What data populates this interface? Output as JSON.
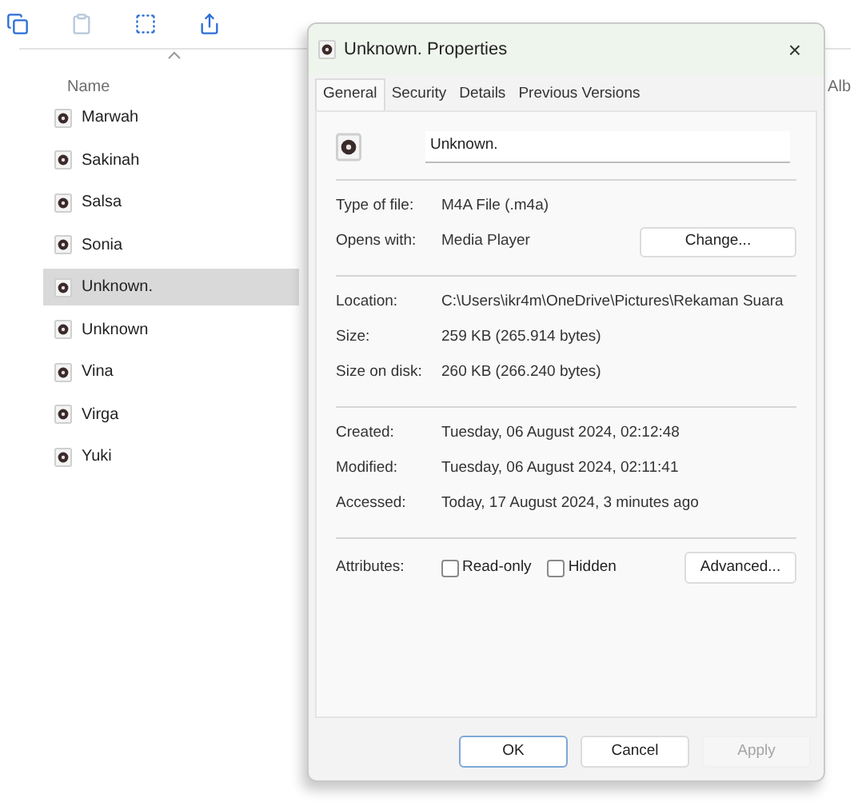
{
  "explorer": {
    "columns": [
      {
        "label": "Name",
        "sorted": true
      },
      {
        "label": "Alb",
        "sorted": false
      }
    ],
    "files": [
      {
        "name": "Marwah",
        "selected": false
      },
      {
        "name": "Sakinah",
        "selected": false
      },
      {
        "name": "Salsa",
        "selected": false
      },
      {
        "name": "Sonia",
        "selected": false
      },
      {
        "name": "Unknown.",
        "selected": true
      },
      {
        "name": "Unknown",
        "selected": false
      },
      {
        "name": "Vina",
        "selected": false
      },
      {
        "name": "Virga",
        "selected": false
      },
      {
        "name": "Yuki",
        "selected": false
      }
    ]
  },
  "dialog": {
    "title": "Unknown. Properties",
    "close": "×",
    "tabs": [
      {
        "label": "General",
        "selected": true
      },
      {
        "label": "Security",
        "selected": false
      },
      {
        "label": "Details",
        "selected": false
      },
      {
        "label": "Previous Versions",
        "selected": false
      }
    ],
    "file_name": "Unknown.",
    "sections": [
      [
        {
          "label": "Type of file:",
          "value": "M4A File (.m4a)"
        },
        {
          "label": "Opens with:",
          "value": "Media Player",
          "button": "Change..."
        }
      ],
      [
        {
          "label": "Location:",
          "value": "C:\\Users\\ikr4m\\OneDrive\\Pictures\\Rekaman Suara"
        },
        {
          "label": "Size:",
          "value": "259 KB (265.914 bytes)"
        },
        {
          "label": "Size on disk:",
          "value": "260 KB (266.240 bytes)"
        }
      ],
      [
        {
          "label": "Created:",
          "value": "Tuesday, 06 August 2024, 02:12:48"
        },
        {
          "label": "Modified:",
          "value": "Tuesday, 06 August 2024, 02:11:41"
        },
        {
          "label": "Accessed:",
          "value": "Today, 17 August 2024, 3 minutes ago"
        }
      ]
    ],
    "attributes": {
      "label": "Attributes:",
      "checkboxes": [
        {
          "label": "Read-only",
          "checked": false
        },
        {
          "label": "Hidden",
          "checked": false
        }
      ],
      "button": "Advanced..."
    },
    "buttons": [
      {
        "label": "OK",
        "default": true,
        "disabled": false
      },
      {
        "label": "Cancel",
        "default": false,
        "disabled": false
      },
      {
        "label": "Apply",
        "default": false,
        "disabled": true
      }
    ]
  }
}
